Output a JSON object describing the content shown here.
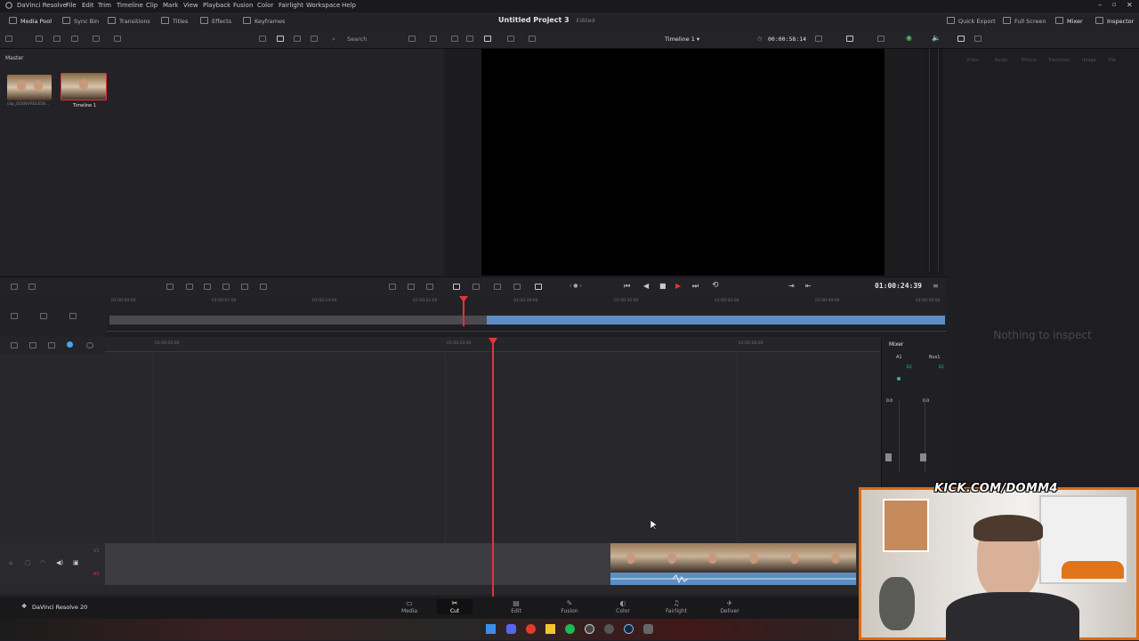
{
  "app": {
    "name": "DaVinci Resolve",
    "menus": [
      "File",
      "Edit",
      "Trim",
      "Timeline",
      "Clip",
      "Mark",
      "View",
      "Playback",
      "Fusion",
      "Color",
      "Fairlight",
      "Workspace",
      "Help"
    ]
  },
  "toolbar": {
    "media_pool": "Media Pool",
    "sync_bin": "Sync Bin",
    "transitions": "Transitions",
    "titles": "Titles",
    "effects": "Effects",
    "keyframes": "Keyframes",
    "project_title": "Untitled Project 3",
    "project_status": "Edited",
    "quick_export": "Quick Export",
    "full_screen": "Full Screen",
    "mixer": "Mixer",
    "inspector": "Inspector"
  },
  "subbar": {
    "search_placeholder": "Search",
    "timeline_name": "Timeline 1",
    "duration": "00:00:58:14"
  },
  "media_pool": {
    "bin": "Master",
    "items": [
      {
        "label": "clip_01KNVFEE458..."
      },
      {
        "label": "Timeline 1"
      }
    ]
  },
  "transport": {
    "timecode": "01:00:24:39"
  },
  "ruler_top": {
    "ticks": [
      "01:00:00:00",
      "01:00:07:00",
      "01:00:14:00",
      "01:00:21:00",
      "01:00:28:00",
      "01:00:35:00",
      "01:00:42:00",
      "01:00:49:00",
      "01:00:56:00"
    ]
  },
  "ruler_main": {
    "ticks": [
      "01:00:20:00",
      "01:00:24:00",
      "01:00:28:00"
    ]
  },
  "tracks": {
    "v1": "V1",
    "a1": "A1"
  },
  "mixer": {
    "title": "Mixer",
    "channels": [
      {
        "name": "A1",
        "value": "0.0"
      },
      {
        "name": "Bus1",
        "value": "0.0"
      }
    ],
    "eq": "EQ"
  },
  "inspector": {
    "tabs": [
      "Video",
      "Audio",
      "Effects",
      "Transition",
      "Image",
      "File"
    ],
    "empty": "Nothing to inspect"
  },
  "pages": [
    {
      "label": "Media",
      "icon": "media-icon"
    },
    {
      "label": "Cut",
      "icon": "cut-icon",
      "active": true
    },
    {
      "label": "Edit",
      "icon": "edit-icon"
    },
    {
      "label": "Fusion",
      "icon": "fusion-icon"
    },
    {
      "label": "Color",
      "icon": "color-icon"
    },
    {
      "label": "Fairlight",
      "icon": "fairlight-icon"
    },
    {
      "label": "Deliver",
      "icon": "deliver-icon"
    }
  ],
  "footer": {
    "version": "DaVinci Resolve 20"
  },
  "overlay": {
    "stream_url": "KICK.COM/DOMM4"
  },
  "colors": {
    "accent_playhead": "#e0343a",
    "clip_blue": "#5b8fc4",
    "overlay_border": "#e06a10"
  }
}
